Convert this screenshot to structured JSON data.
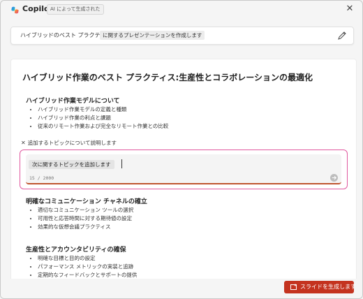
{
  "app": {
    "title": "Copilot",
    "ai_badge": "AI によって生成された"
  },
  "prompt": {
    "text": "ハイブリッドのベスト プラクティス",
    "chip": "に関するプレゼンテーションを作成します"
  },
  "document": {
    "title": "ハイブリッド作業のベスト プラクティス:生産性とコラボレーションの最適化",
    "sections": [
      {
        "heading": "ハイブリッド作業モデルについて",
        "bullets": [
          "ハイブリッド作業モデルの定義と種類",
          "ハイブリッド作業の利点と課題",
          "従来のリモート作業および完全なリモート作業との比較"
        ]
      },
      {
        "heading": "明確なコミュニケーション チャネルの確立",
        "bullets": [
          "適切なコミュニケーション ツールの選択",
          "可用性と応答時間に対する期待値の設定",
          "効果的な仮想会議プラクティス"
        ]
      },
      {
        "heading": "生産性とアカウンタビリティの確保",
        "bullets": [
          "明確な目標と目的の設定",
          "パフォーマンス メトリックの実装と追跡",
          "定期的なフィードバックとサポートの提供"
        ]
      }
    ]
  },
  "add_topic": {
    "label": "追加するトピックについて説明します",
    "chip": "次に関するトピックを追加します",
    "counter": "15 / 2000"
  },
  "footer": {
    "generate_label": "スライドを生成します"
  },
  "colors": {
    "accent_red": "#c4331f",
    "focus_ring": "#e0589f"
  },
  "icons": {
    "close": "close-icon",
    "edit": "pencil-icon",
    "send": "send-icon",
    "slides": "slides-icon"
  }
}
